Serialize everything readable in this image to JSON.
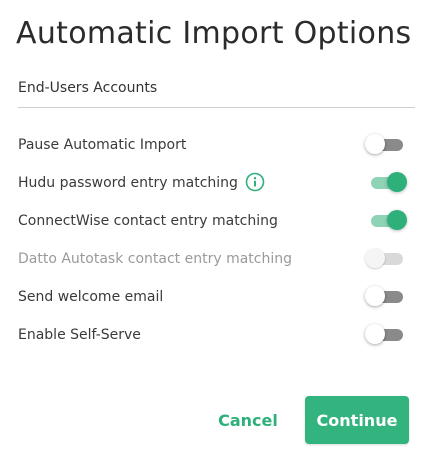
{
  "dialog": {
    "title": "Automatic Import Options",
    "section_header": "End-Users Accounts"
  },
  "options": [
    {
      "label": "Pause Automatic Import",
      "checked": false,
      "disabled": false
    },
    {
      "label": "Hudu password entry matching",
      "checked": true,
      "disabled": false,
      "icon": "info-icon"
    },
    {
      "label": "ConnectWise contact entry matching",
      "checked": true,
      "disabled": false
    },
    {
      "label": "Datto Autotask contact entry matching",
      "checked": false,
      "disabled": true
    },
    {
      "label": "Send welcome email",
      "checked": false,
      "disabled": false
    },
    {
      "label": "Enable Self-Serve",
      "checked": false,
      "disabled": false
    }
  ],
  "footer": {
    "cancel_label": "Cancel",
    "continue_label": "Continue"
  },
  "colors": {
    "accent": "#2fb07b",
    "accent_light": "#8fd3b6",
    "toggle_off_track": "#8a8a8a",
    "disabled_text": "#9a9a9a"
  }
}
